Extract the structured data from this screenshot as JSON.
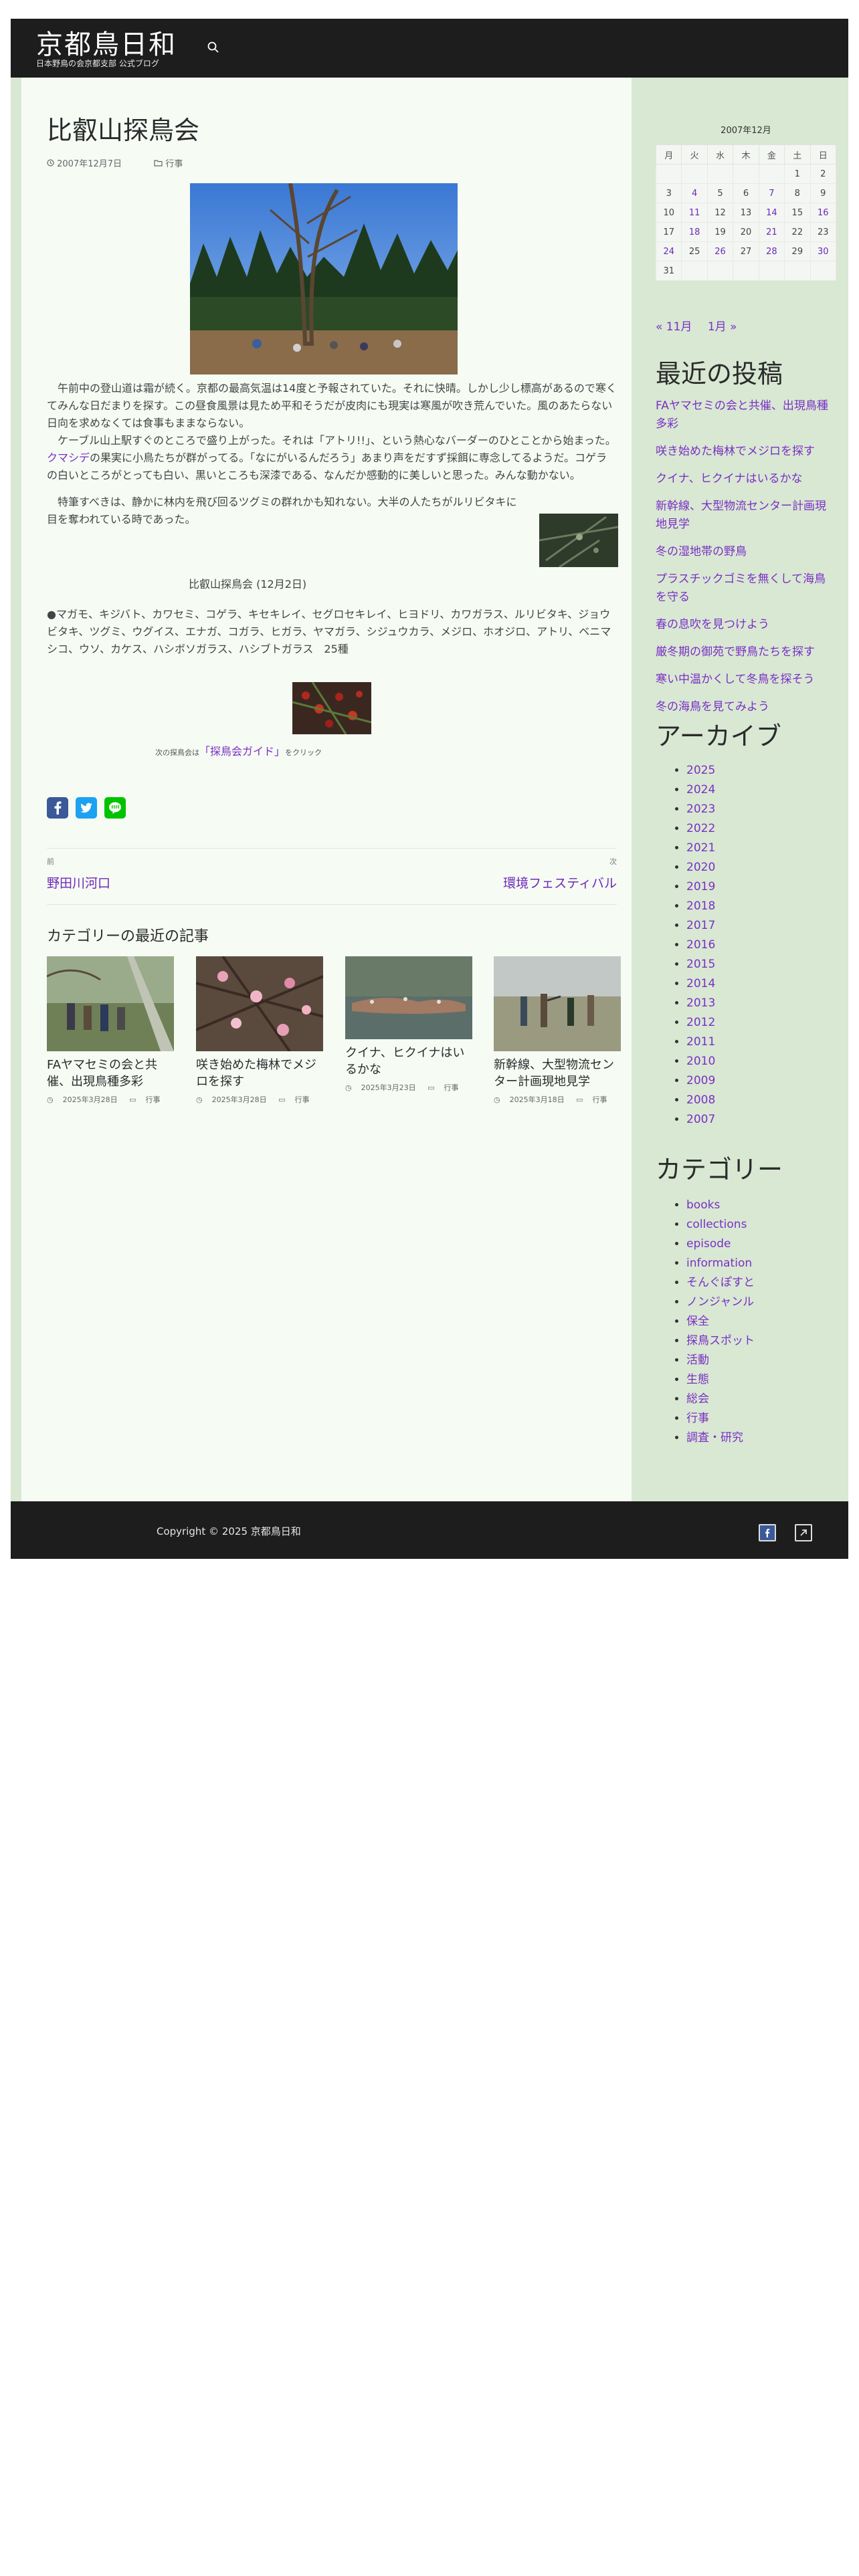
{
  "site": {
    "title": "京都鳥日和",
    "description": "日本野鳥の会京都支部 公式ブログ"
  },
  "post": {
    "title": "比叡山探鳥会",
    "date": "2007年12月7日",
    "category": "行事",
    "para1": "午前中の登山道は霜が続く。京都の最高気温は14度と予報されていた。それに快晴。しかし少し標高があるので寒くてみんな日だまりを探す。この昼食風景は見ため平和そうだが皮肉にも現実は寒風が吹き荒んでいた。風のあたらない日向を求めなくては食事もままならない。",
    "para2a": "ケーブル山上駅すぐのところで盛り上がった。それは「アトリ!!」、という熱心なバーダーのひとことから始まった。",
    "para2_link": "クマシデ",
    "para2b": "の果実に小鳥たちが群がってる。「なにがいるんだろう」あまり声をだすず採餌に専念してるようだ。コゲラの白いところがとっても白い、黒いところも深漆である、なんだか感動的に美しいと思った。みんな動かない。",
    "para3": "特筆すべきは、静かに林内を飛び回るツグミの群れかも知れない。大半の人たちがルリビタキに目を奪われている時であった。",
    "caption": "比叡山探鳥会 (12月2日)",
    "birds": "●マガモ、キジバト、カワセミ、コゲラ、キセキレイ、セグロセキレイ、ヒヨドリ、カワガラス、ルリビタキ、ジョウビタキ、ツグミ、ウグイス、エナガ、コガラ、ヒガラ、ヤマガラ、シジュウカラ、メジロ、ホオジロ、アトリ、ベニマシコ、ウソ、カケス、ハシボソガラス、ハシブトガラス　25種",
    "guide_prefix": "次の探鳥会は",
    "guide_link": "「探鳥会ガイド」",
    "guide_suffix": "をクリック"
  },
  "share": {
    "facebook": "Facebook",
    "twitter": "Twitter",
    "line": "Line"
  },
  "nav": {
    "prev_label": "前",
    "prev_title": "野田川河口",
    "next_label": "次",
    "next_title": "環境フェスティバル"
  },
  "related": {
    "heading": "カテゴリーの最近の記事",
    "items": [
      {
        "title": "FAヤマセミの会と共催、出現鳥種多彩",
        "date": "2025年3月28日",
        "category": "行事"
      },
      {
        "title": "咲き始めた梅林でメジロを探す",
        "date": "2025年3月28日",
        "category": "行事"
      },
      {
        "title": "クイナ、ヒクイナはいるかな",
        "date": "2025年3月23日",
        "category": "行事"
      },
      {
        "title": "新幹線、大型物流センター計画現地見学",
        "date": "2025年3月18日",
        "category": "行事"
      }
    ]
  },
  "calendar": {
    "caption": "2007年12月",
    "weekdays": [
      "月",
      "火",
      "水",
      "木",
      "金",
      "土",
      "日"
    ],
    "weeks": [
      [
        "",
        "",
        "",
        "",
        "",
        "1",
        "2"
      ],
      [
        "3",
        "4",
        "5",
        "6",
        "7",
        "8",
        "9"
      ],
      [
        "10",
        "11",
        "12",
        "13",
        "14",
        "15",
        "16"
      ],
      [
        "17",
        "18",
        "19",
        "20",
        "21",
        "22",
        "23"
      ],
      [
        "24",
        "25",
        "26",
        "27",
        "28",
        "29",
        "30"
      ],
      [
        "31",
        "",
        "",
        "",
        "",
        "",
        ""
      ]
    ],
    "linked_days": [
      "4",
      "7",
      "11",
      "14",
      "16",
      "18",
      "21",
      "24",
      "26",
      "28",
      "30"
    ],
    "prev": "« 11月",
    "next": "1月 »"
  },
  "sidebar": {
    "recent_heading": "最近の投稿",
    "recent": [
      "FAヤマセミの会と共催、出現鳥種多彩",
      "咲き始めた梅林でメジロを探す",
      "クイナ、ヒクイナはいるかな",
      "新幹線、大型物流センター計画現地見学",
      "冬の湿地帯の野鳥",
      "プラスチックゴミを無くして海鳥を守る",
      "春の息吹を見つけよう",
      "厳冬期の御苑で野鳥たちを探す",
      "寒い中温かくして冬鳥を探そう",
      "冬の海鳥を見てみよう"
    ],
    "archive_heading": "アーカイブ",
    "archives": [
      "2025",
      "2024",
      "2023",
      "2022",
      "2021",
      "2020",
      "2019",
      "2018",
      "2017",
      "2016",
      "2015",
      "2014",
      "2013",
      "2012",
      "2011",
      "2010",
      "2009",
      "2008",
      "2007"
    ],
    "category_heading": "カテゴリー",
    "categories": [
      "books",
      "collections",
      "episode",
      "information",
      "そんぐぽすと",
      "ノンジャンル",
      "保全",
      "探鳥スポット",
      "活動",
      "生態",
      "総会",
      "行事",
      "調査・研究"
    ]
  },
  "footer": {
    "copyright": "Copyright © 2025 京都鳥日和"
  },
  "colors": {
    "header_bg": "#1d1d1d",
    "link": "#6d28b8",
    "sidebar_bg": "#d8e8d3",
    "content_bg": "#f6fbf4",
    "facebook": "#3b5998",
    "twitter": "#1da1f2",
    "line": "#00c300"
  }
}
